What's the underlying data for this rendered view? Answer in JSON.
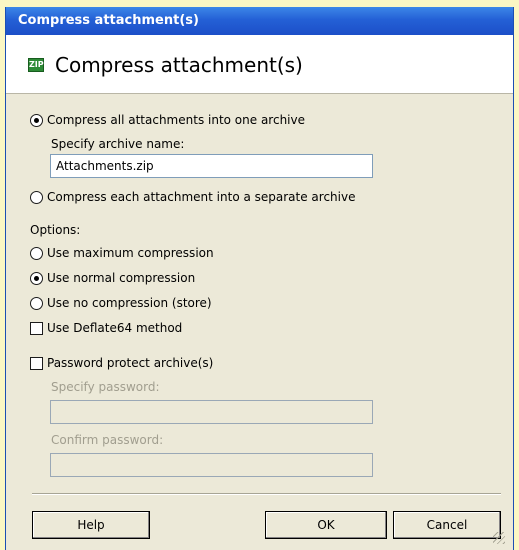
{
  "window": {
    "title": "Compress attachment(s)"
  },
  "header": {
    "icon": "zip-archive-icon",
    "icon_text": "ZIP",
    "title": "Compress attachment(s)"
  },
  "archive_mode": {
    "one_archive_label": "Compress all attachments into one archive",
    "one_archive_selected": true,
    "name_label": "Specify archive name:",
    "name_value": "Attachments.zip",
    "separate_label": "Compress each attachment into a separate archive",
    "separate_selected": false
  },
  "options": {
    "heading": "Options:",
    "maximum_label": "Use maximum compression",
    "normal_label": "Use normal compression",
    "store_label": "Use no compression (store)",
    "selected": "normal",
    "deflate64_label": "Use Deflate64 method",
    "deflate64_checked": false
  },
  "password": {
    "protect_label": "Password protect archive(s)",
    "protect_checked": false,
    "specify_label": "Specify password:",
    "specify_value": "",
    "confirm_label": "Confirm password:",
    "confirm_value": ""
  },
  "buttons": {
    "help": "Help",
    "ok": "OK",
    "cancel": "Cancel"
  },
  "colors": {
    "titlebar": "#2460d6",
    "dialog_bg": "#ece9d8",
    "header_bg": "#ffffff",
    "page_bg": "#fbf7c4"
  }
}
